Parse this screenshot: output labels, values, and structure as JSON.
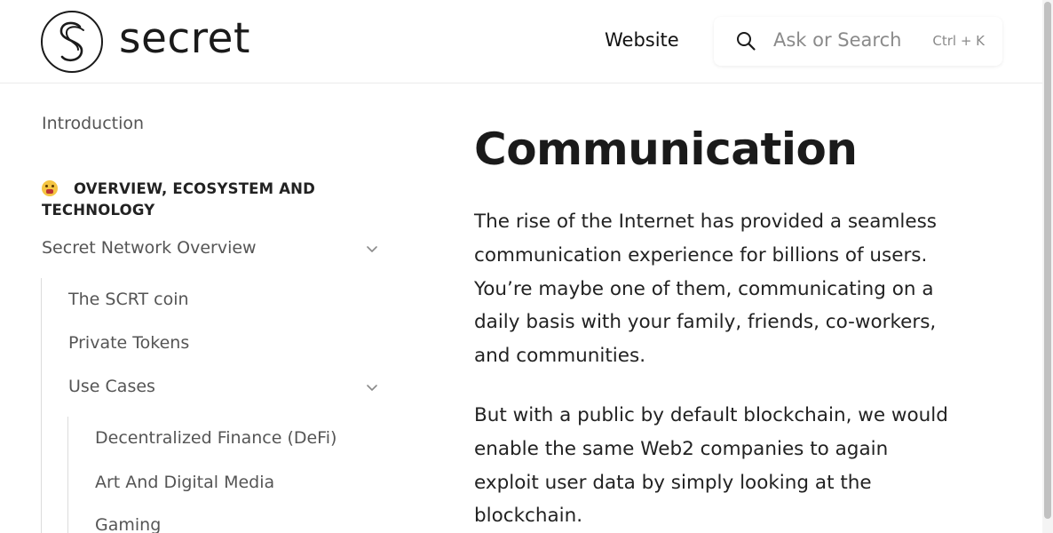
{
  "header": {
    "logo_text": "secret",
    "nav_website": "Website",
    "search_placeholder": "Ask or Search",
    "search_shortcut": "Ctrl + K"
  },
  "sidebar": {
    "introduction": "Introduction",
    "section_title": "OVERVIEW, ECOSYSTEM AND TECHNOLOGY",
    "section_icon": "shushing-face-emoji",
    "items": [
      {
        "label": "Secret Network Overview",
        "expanded": true
      },
      {
        "label": "The SCRT coin"
      },
      {
        "label": "Private Tokens"
      },
      {
        "label": "Use Cases",
        "expanded": true
      },
      {
        "label": "Decentralized Finance (DeFi)"
      },
      {
        "label": "Art And Digital Media"
      },
      {
        "label": "Gaming"
      }
    ]
  },
  "main": {
    "title": "Communication",
    "paragraphs": [
      "The rise of the Internet has provided a seamless communication experience for billions of users. You’re maybe one of them, communicating on a daily basis with your family, friends, co-workers, and communities.",
      "But with a public by default blockchain, we would enable the same Web2 companies to again exploit user data by simply looking at the blockchain."
    ]
  },
  "colors": {
    "text_primary": "#1f1f1f",
    "text_muted": "#555555",
    "border": "#ebebeb"
  }
}
